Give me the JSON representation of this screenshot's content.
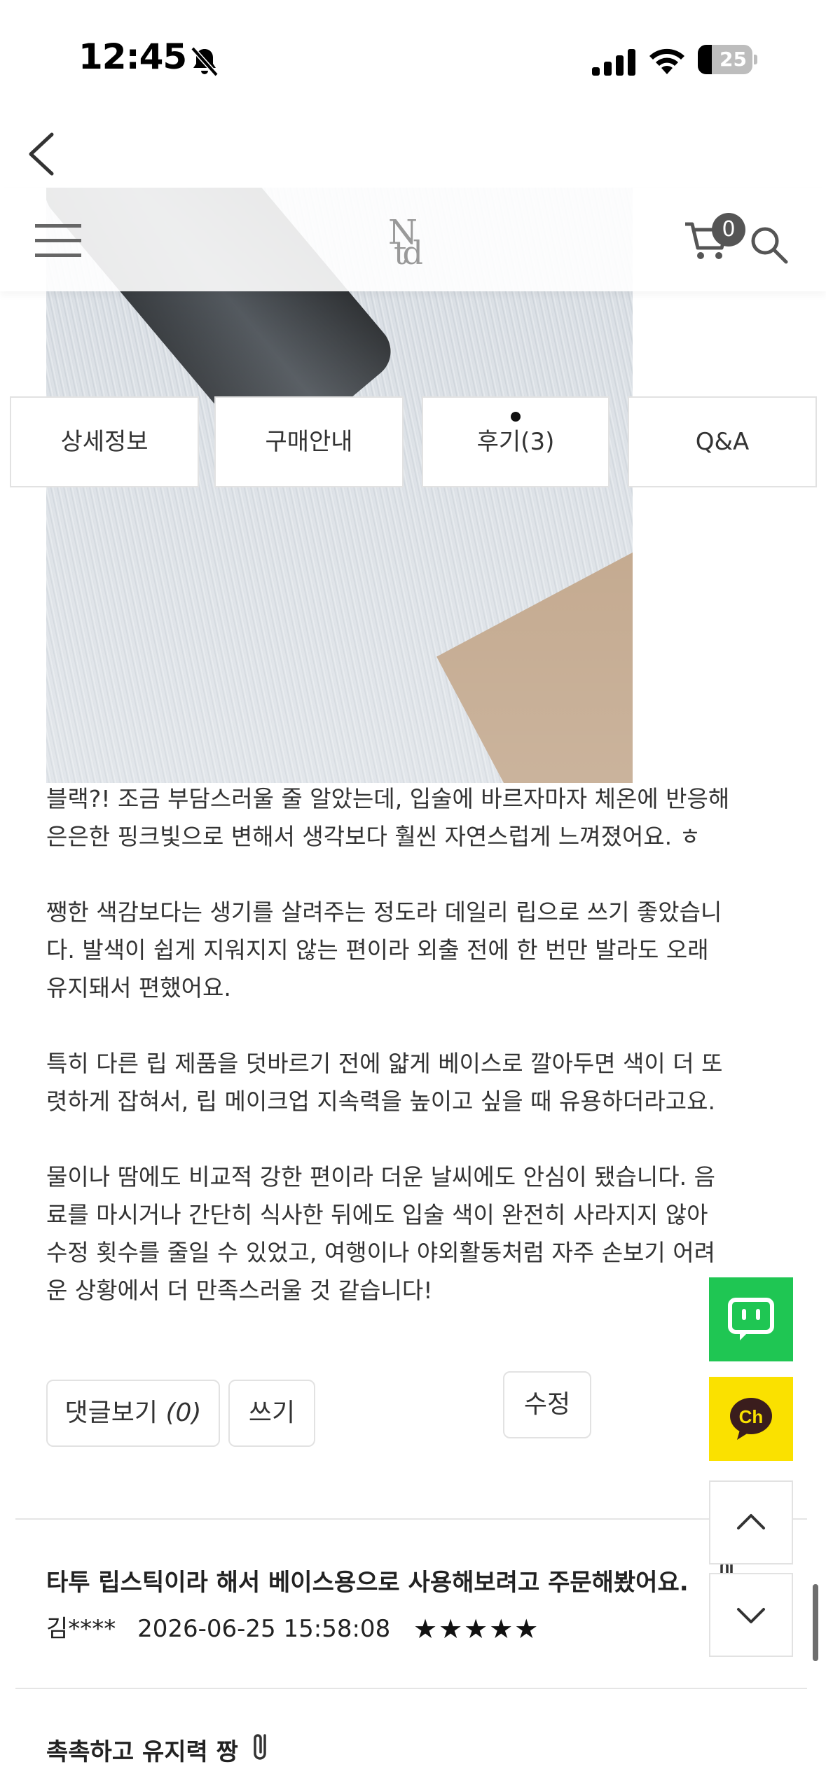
{
  "status_bar": {
    "time": "12:45",
    "battery_level": "25",
    "battery_fraction": 0.25,
    "icons": [
      "bell-slash-icon",
      "signal-icon",
      "wifi-icon",
      "battery-icon"
    ]
  },
  "header": {
    "logo_n": "N",
    "logo_td": "td",
    "cart_count": "0"
  },
  "tabs": [
    {
      "label": "상세정보",
      "active": false
    },
    {
      "label": "구매안내",
      "active": false
    },
    {
      "label": "후기(3)",
      "active": true
    },
    {
      "label": "Q&A",
      "active": false
    }
  ],
  "review": {
    "paragraphs": [
      "블랙?! 조금 부담스러울 줄 알았는데, 입술에 바르자마자 체온에 반응해\n은은한 핑크빛으로 변해서 생각보다 훨씬 자연스럽게 느껴졌어요. ㅎ",
      "쨍한 색감보다는 생기를 살려주는 정도라 데일리 립으로 쓰기 좋았습니\n다. 발색이 쉽게 지워지지 않는 편이라 외출 전에 한 번만 발라도 오래\n유지돼서 편했어요.",
      "특히 다른 립 제품을 덧바르기 전에 얇게 베이스로 깔아두면 색이 더 또\n렷하게 잡혀서, 립 메이크업 지속력을 높이고 싶을 때 유용하더라고요.",
      "물이나 땀에도 비교적 강한 편이라 더운 날씨에도 안심이 됐습니다. 음\n료를 마시거나 간단히 식사한 뒤에도 입술 색이 완전히 사라지지 않아\n수정 횟수를 줄일 수 있었고, 여행이나 야외활동처럼 자주 손보기 어려\n운 상황에서 더 만족스러울 것 같습니다!"
    ],
    "buttons": {
      "view_comments": "댓글보기",
      "comment_count": "(0)",
      "write": "쓰기",
      "edit": "수정"
    }
  },
  "review_list": [
    {
      "title": "타투 립스틱이라 해서 베이스용으로 사용해보려고 주문해봤어요.",
      "author": "김****",
      "date": "2026-06-25 15:58:08",
      "stars": "★★★★★"
    },
    {
      "title": "촉촉하고 유지력 짱",
      "author": "",
      "date": "",
      "stars": ""
    }
  ],
  "colors": {
    "talk_green": "#1fc653",
    "kakao_yellow": "#fae100"
  }
}
